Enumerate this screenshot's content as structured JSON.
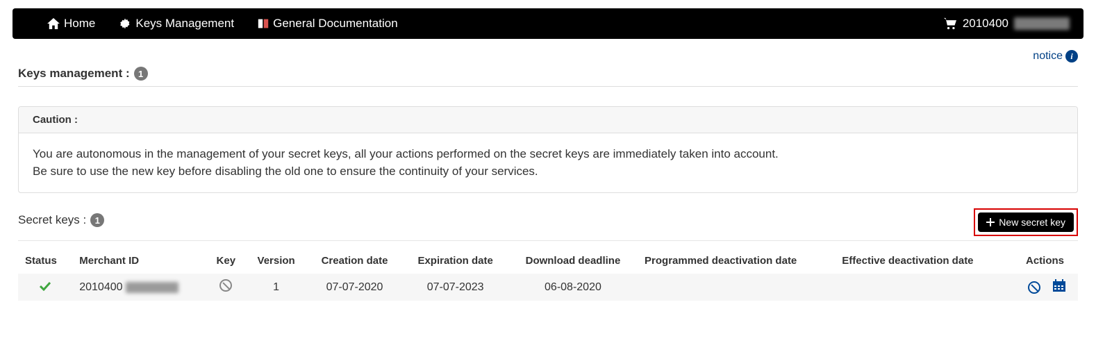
{
  "nav": {
    "home": "Home",
    "keys_mgmt": "Keys Management",
    "general_doc": "General Documentation",
    "merchant_prefix": "2010400"
  },
  "notice_label": "notice",
  "keys_mgmt_title": "Keys management :",
  "keys_mgmt_count": "1",
  "caution": {
    "title": "Caution :",
    "line1": "You are autonomous in the management of your secret keys, all your actions performed on the secret keys are immediately taken into account.",
    "line2": "Be sure to use the new key before disabling the old one to ensure the continuity of your services."
  },
  "secret_keys_title": "Secret keys :",
  "secret_keys_count": "1",
  "new_key_btn": "New secret key",
  "table": {
    "headers": {
      "status": "Status",
      "merchant_id": "Merchant ID",
      "key": "Key",
      "version": "Version",
      "creation": "Creation date",
      "expiration": "Expiration date",
      "download": "Download deadline",
      "prog_deact": "Programmed deactivation date",
      "eff_deact": "Effective deactivation date",
      "actions": "Actions"
    },
    "row": {
      "merchant_prefix": "2010400",
      "version": "1",
      "creation": "07-07-2020",
      "expiration": "07-07-2023",
      "download": "06-08-2020",
      "prog_deact": "",
      "eff_deact": ""
    }
  }
}
